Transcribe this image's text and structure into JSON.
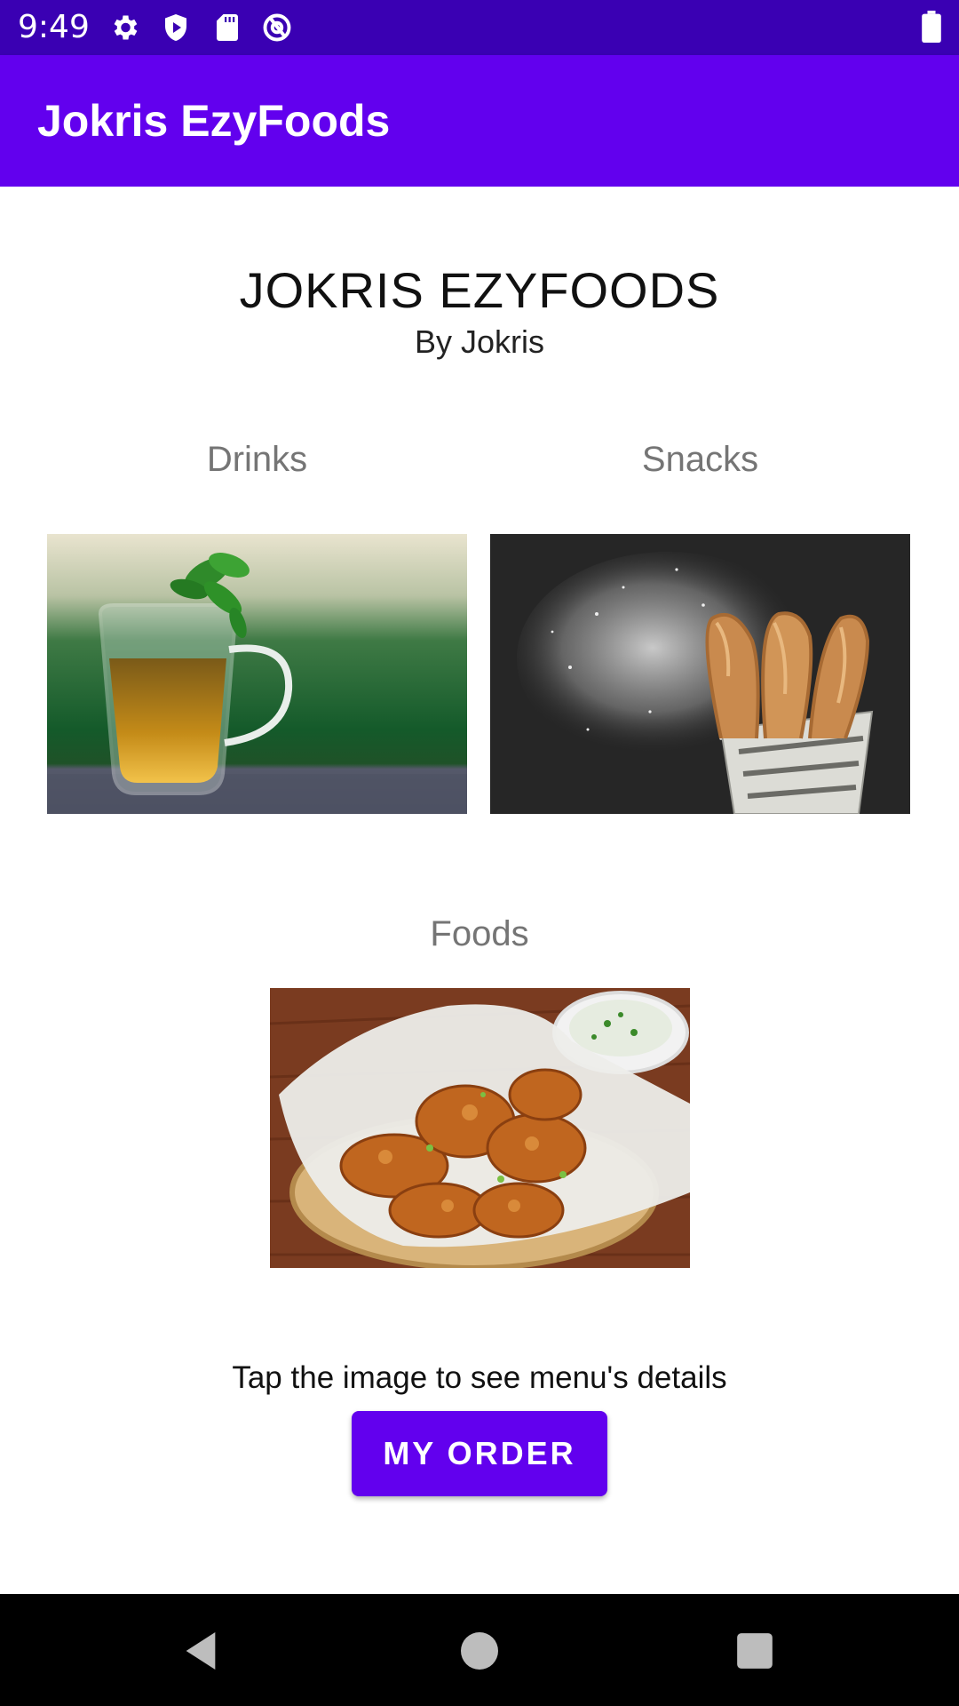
{
  "status_bar": {
    "time": "9:49",
    "icons": [
      "gear-icon",
      "shield-play-icon",
      "sd-card-icon",
      "at-sign-icon",
      "battery-icon"
    ]
  },
  "app_bar": {
    "title": "Jokris EzyFoods",
    "color": "#6200ee"
  },
  "main": {
    "title": "JOKRIS EZYFOODS",
    "subtitle": "By Jokris",
    "categories": [
      {
        "label": "Drinks",
        "image": "tea-cup-photo"
      },
      {
        "label": "Snacks",
        "image": "churros-photo"
      },
      {
        "label": "Foods",
        "image": "fried-chicken-photo"
      }
    ],
    "hint": "Tap the image to see menu's details",
    "order_button": "MY ORDER"
  },
  "nav_bar": {
    "buttons": [
      "back-icon",
      "home-icon",
      "recents-icon"
    ]
  }
}
